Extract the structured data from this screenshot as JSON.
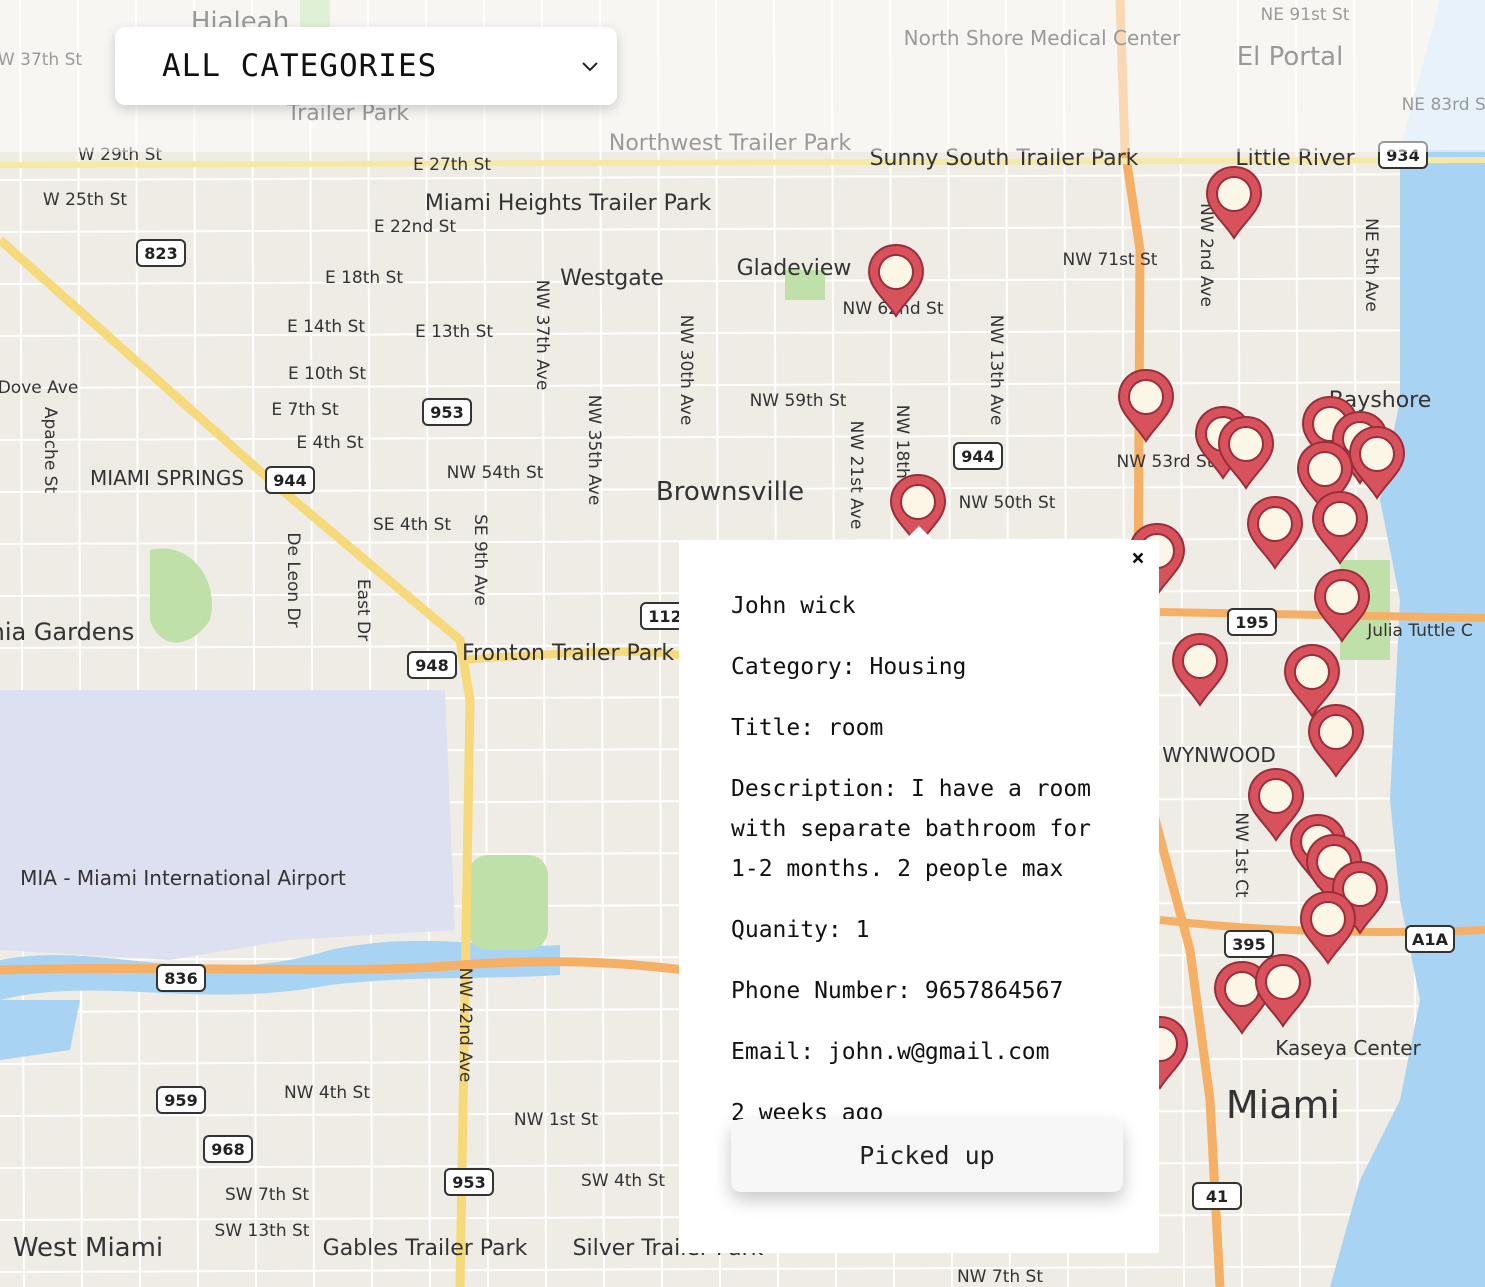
{
  "filter": {
    "selected": "ALL CATEGORIES"
  },
  "map_labels": {
    "places": [
      "Hialeah",
      "North Shore Medical Center",
      "El Portal",
      "Trailer Park",
      "Northwest Trailer Park",
      "Sunny South Trailer Park",
      "Little River",
      "Miami Heights Trailer Park",
      "Westgate",
      "Gladeview",
      "MIAMI SPRINGS",
      "Brownsville",
      "Bayshore",
      "Virginia Gardens",
      "Fronton Trailer Park",
      "WYNWOOD",
      "MIA - Miami International Airport",
      "Kaseya Center",
      "Miami",
      "West Miami",
      "Gables Trailer Park",
      "Silver Trailer Park"
    ],
    "streets": [
      "W 37th St",
      "W 29th St",
      "W 25th St",
      "E 27th St",
      "E 22nd St",
      "E 18th St",
      "E 14th St",
      "E 13th St",
      "E 10th St",
      "E 7th St",
      "E 4th St",
      "SE 4th St",
      "Dove Ave",
      "Apache St",
      "De Leon Dr",
      "East Dr",
      "SE 9th Ave",
      "NW 37th Ave",
      "NW 35th Ave",
      "NW 30th Ave",
      "NW 21st Ave",
      "NW 18th Ave",
      "NW 13th Ave",
      "NW 2nd Ave",
      "NE 5th Ave",
      "NW 71st St",
      "NW 59th St",
      "NW 54th St",
      "NW 53rd St",
      "NW 50th St",
      "NW 62nd St",
      "NE 91st St",
      "NE 83rd St",
      "Julia Tuttle C",
      "NW 42nd Ave",
      "NW 4th St",
      "NW 1st St",
      "NW 1st Ct",
      "SW 4th St",
      "SW 7th St",
      "SW 13th St",
      "NW 7th St"
    ],
    "shields": [
      "934",
      "823",
      "953",
      "944",
      "944",
      "948",
      "112",
      "195",
      "836",
      "959",
      "968",
      "953",
      "395",
      "A1A",
      "41"
    ]
  },
  "popup": {
    "name": "John wick",
    "category": "Category: Housing",
    "title": "Title: room",
    "description": "Description: I have a room with separate bathroom for 1-2 months. 2 people max",
    "quantity": "Quanity: 1",
    "phone": "Phone Number: 9657864567",
    "email": "Email: john.w@gmail.com",
    "time": "2 weeks ago",
    "button": "Picked up",
    "close": "×"
  },
  "colors": {
    "marker": "#d8525e",
    "marker_inner": "#fbf6e6",
    "water": "#a9d3f2",
    "highway": "#f5b066",
    "freeway": "#f6d97a",
    "park": "#bfe0a8"
  }
}
